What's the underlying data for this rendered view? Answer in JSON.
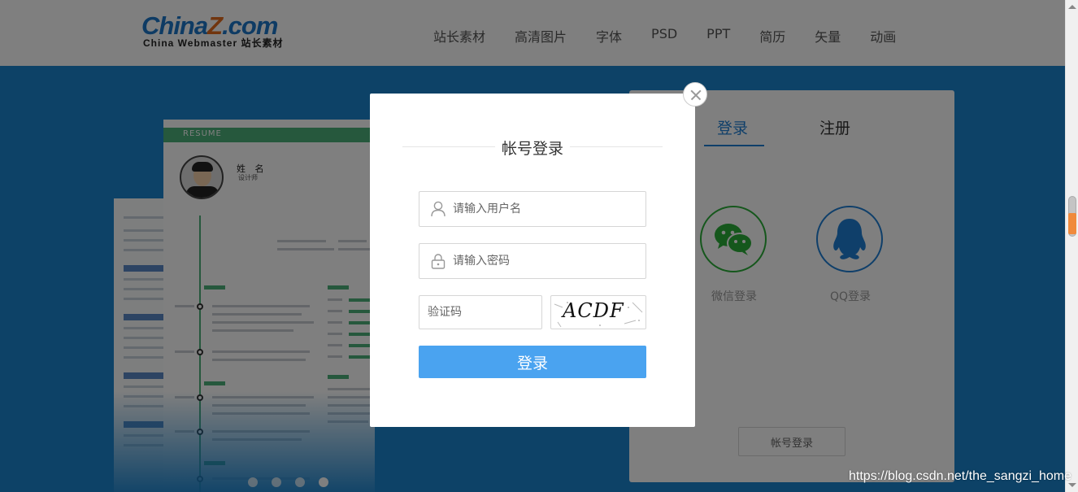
{
  "header": {
    "logo_main": "China",
    "logo_z": "Z",
    "logo_tld": ".com",
    "logo_sub": "China Webmaster 站长素材",
    "nav": [
      "站长素材",
      "高清图片",
      "字体",
      "PSD",
      "PPT",
      "简历",
      "矢量",
      "动画"
    ]
  },
  "banner": {
    "resume_band": "RESUME",
    "resume_name": "姓 名",
    "resume_role": "设计师",
    "carousel_dots": 4,
    "active_dot": 4
  },
  "panel": {
    "tab_login": "登录",
    "tab_register": "注册",
    "wechat_label": "微信登录",
    "qq_label": "QQ登录",
    "account_login_button": "帐号登录"
  },
  "modal": {
    "title": "帐号登录",
    "username_placeholder": "请输入用户名",
    "password_placeholder": "请输入密码",
    "captcha_placeholder": "验证码",
    "captcha_text": "ACDF",
    "submit_label": "登录",
    "icons": [
      "user-icon",
      "lock-icon",
      "close-icon"
    ]
  },
  "watermark": "https://blog.csdn.net/the_sangzi_home",
  "colors": {
    "brand_blue": "#1e7ed4",
    "banner_bg": "#1b84cf",
    "submit_bg": "#4aa3f0",
    "wechat_green": "#2aae38",
    "resume_green": "#4db07a"
  }
}
